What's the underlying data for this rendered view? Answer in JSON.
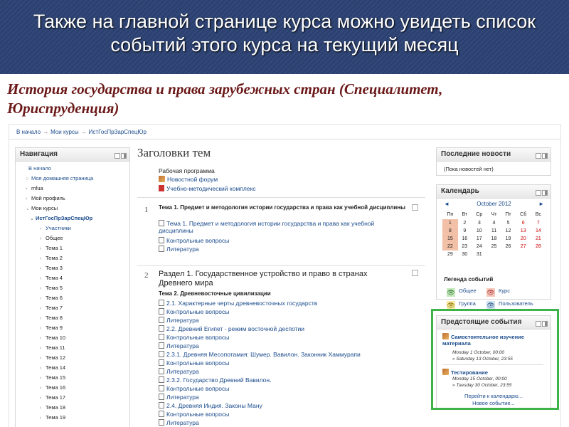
{
  "slide": {
    "title": "Также на главной странице курса можно увидеть список событий этого курса на текущий месяц"
  },
  "course": {
    "title": "История государства и права зарубежных стран (Специалитет, Юриспруденция)"
  },
  "breadcrumb": [
    "В начало",
    "Мои курсы",
    "ИстГосПрЗарСпецЮр"
  ],
  "navigation": {
    "title": "Навигация",
    "items": [
      "В начало",
      "Моя домашняя страница",
      "mfua",
      "Мой профиль",
      "Мои курсы",
      "ИстГосПрЗарСпецЮр",
      "Участники",
      "Общее",
      "Тема 1",
      "Тема 2",
      "Тема 3",
      "Тема 4",
      "Тема 5",
      "Тема 6",
      "Тема 7",
      "Тема 8",
      "Тема 9",
      "Тема 10",
      "Тема 11",
      "Тема 12",
      "Тема 14",
      "Тема 15",
      "Тема 16",
      "Тема 17",
      "Тема 18",
      "Тема 19"
    ]
  },
  "main": {
    "heading": "Заголовки тем",
    "intro": {
      "label": "Рабочая программа",
      "links": [
        "Новостной форум",
        "Учебно-методический комплекс"
      ]
    },
    "section1": {
      "num": "1",
      "title": "Тема 1. Предмет и методология истории государства и права как учебной дисциплины",
      "links": [
        "Тема 1. Предмет и методология истории государства и права как учебной дисциплины",
        "Контрольные вопросы",
        "Литература"
      ]
    },
    "section2": {
      "num": "2",
      "title": "Раздел 1. Государственное устройство и право в странах Древнего мира",
      "subtitle": "Тема 2. Древневосточные цивилизации",
      "links": [
        "2.1. Характерные черты древневосточных государств",
        "Контрольные вопросы",
        "Литература",
        "2.2. Древний Египет - режим восточной деспотии",
        "Контрольные вопросы",
        "Литература",
        "2.3.1. Древняя Месопотамия: Шумер. Вавилон. Законник Хаммурапи",
        "Контрольные вопросы",
        "Литература",
        "2.3.2. Государство Древний Вавилон.",
        "Контрольные вопросы",
        "Литература",
        "2.4. Древняя Индия. Законы Ману",
        "Контрольные вопросы",
        "Литература"
      ]
    }
  },
  "news": {
    "title": "Последние новости",
    "empty": "(Пока новостей нет)"
  },
  "calendar": {
    "title": "Календарь",
    "prev": "◄",
    "next": "►",
    "month": "October 2012",
    "weekdays": [
      "Пн",
      "Вт",
      "Ср",
      "Чт",
      "Пт",
      "Сб",
      "Вс"
    ],
    "weeks": [
      [
        "1",
        "2",
        "3",
        "4",
        "5",
        "6",
        "7"
      ],
      [
        "8",
        "9",
        "10",
        "11",
        "12",
        "13",
        "14"
      ],
      [
        "15",
        "16",
        "17",
        "18",
        "19",
        "20",
        "21"
      ],
      [
        "22",
        "23",
        "24",
        "25",
        "26",
        "27",
        "28"
      ],
      [
        "29",
        "30",
        "31",
        "",
        "",
        "",
        ""
      ]
    ],
    "highlighted_days": [
      "1",
      "8",
      "15",
      "22"
    ],
    "legend_title": "Легенда событий",
    "legend": [
      "Общее",
      "Курс",
      "Группа",
      "Пользователь"
    ]
  },
  "upcoming": {
    "title": "Предстоящие события",
    "events": [
      {
        "title": "Самостоятельное изучение материала",
        "from": "Monday 1 October, 00:00",
        "to": "» Saturday 13 October, 23:55"
      },
      {
        "title": "Тестирование",
        "from": "Monday 15 October, 00:00",
        "to": "» Tuesday 30 October, 23:55"
      }
    ],
    "goto_calendar": "Перейти к календарю...",
    "new_event": "Новое событие..."
  }
}
